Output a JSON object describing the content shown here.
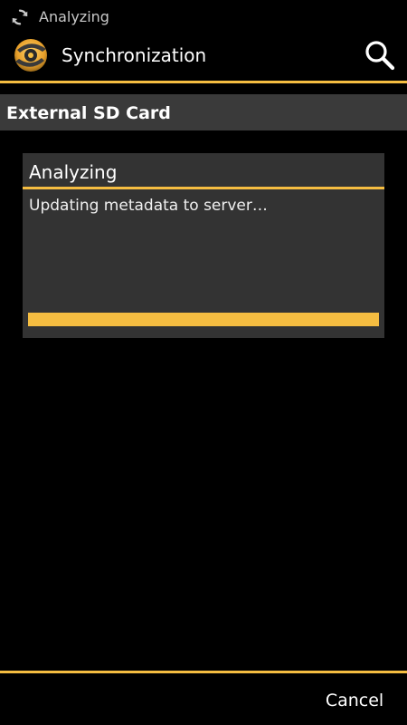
{
  "status_bar": {
    "icon": "sync-icon",
    "text": "Analyzing"
  },
  "action_bar": {
    "logo_icon": "app-logo-icon",
    "title": "Synchronization",
    "search_icon": "search-icon"
  },
  "section": {
    "label": "External SD Card"
  },
  "dialog": {
    "title": "Analyzing",
    "message": "Updating metadata to server…",
    "progress_fraction": 1.0
  },
  "footer": {
    "cancel_label": "Cancel"
  },
  "colors": {
    "accent": "#f5bd41",
    "background": "#000000",
    "dialog_bg": "#333333",
    "section_bg": "#3a3a3a"
  }
}
